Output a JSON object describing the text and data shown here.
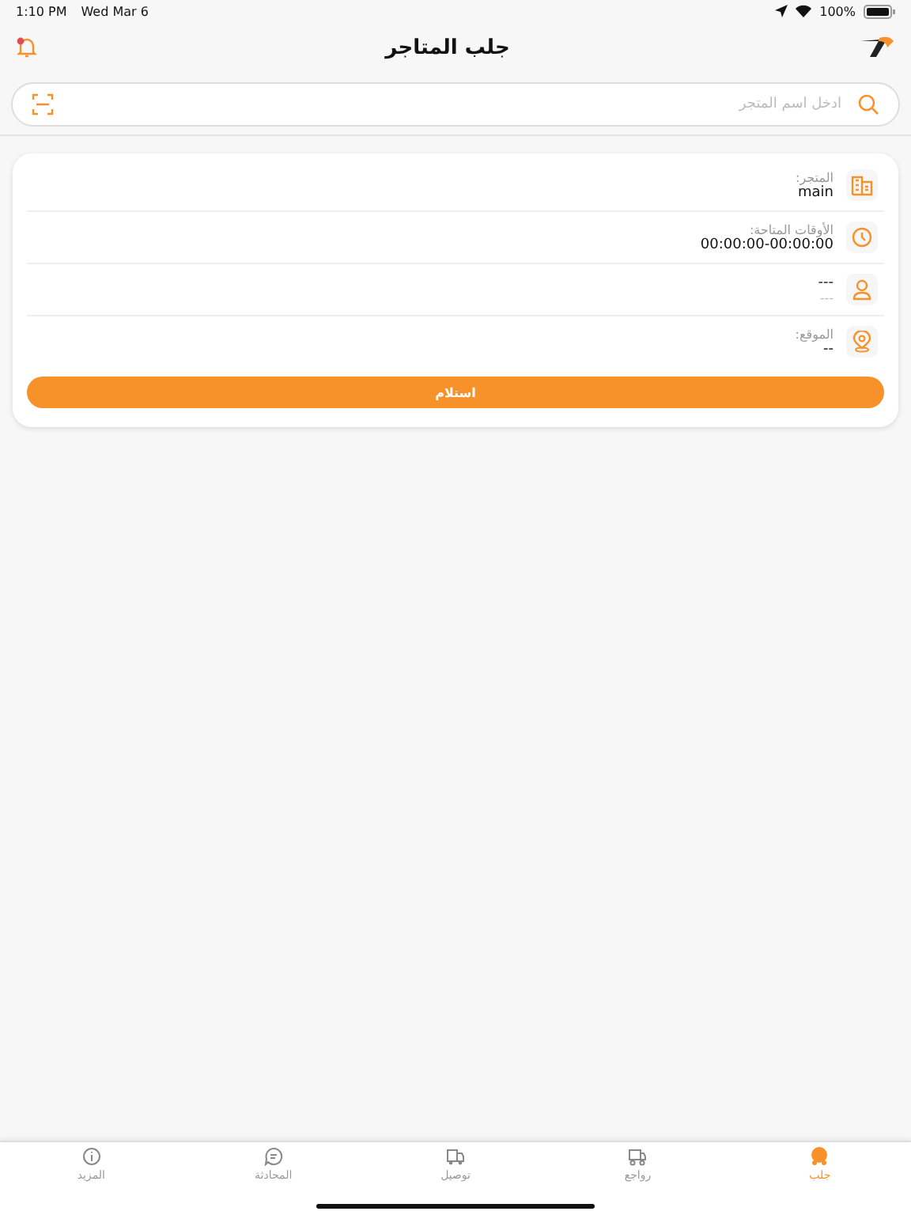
{
  "status_bar": {
    "time": "1:10 PM",
    "date": "Wed Mar 6",
    "battery": "100%"
  },
  "header": {
    "title": "جلب المتاجر",
    "notification_dot": true
  },
  "search": {
    "placeholder": "ادخل اسم المتجر"
  },
  "store_card": {
    "rows": [
      {
        "kind": "store",
        "label": "المتجر:",
        "value": "main"
      },
      {
        "kind": "time",
        "label": "الأوقات المتاحة:",
        "value": "00:00:00-00:00:00"
      },
      {
        "kind": "person",
        "label": "---",
        "value": "---"
      },
      {
        "kind": "location",
        "label": "الموقع:",
        "value": "--"
      }
    ],
    "button": "استلام"
  },
  "tab_bar": [
    {
      "kind": "pickup",
      "label": "جلب",
      "selected": true
    },
    {
      "kind": "returns",
      "label": "رواجع",
      "selected": false
    },
    {
      "kind": "delivery",
      "label": "توصيل",
      "selected": false
    },
    {
      "kind": "chat",
      "label": "المحادثة",
      "selected": false
    },
    {
      "kind": "more",
      "label": "المزيد",
      "selected": false
    }
  ]
}
